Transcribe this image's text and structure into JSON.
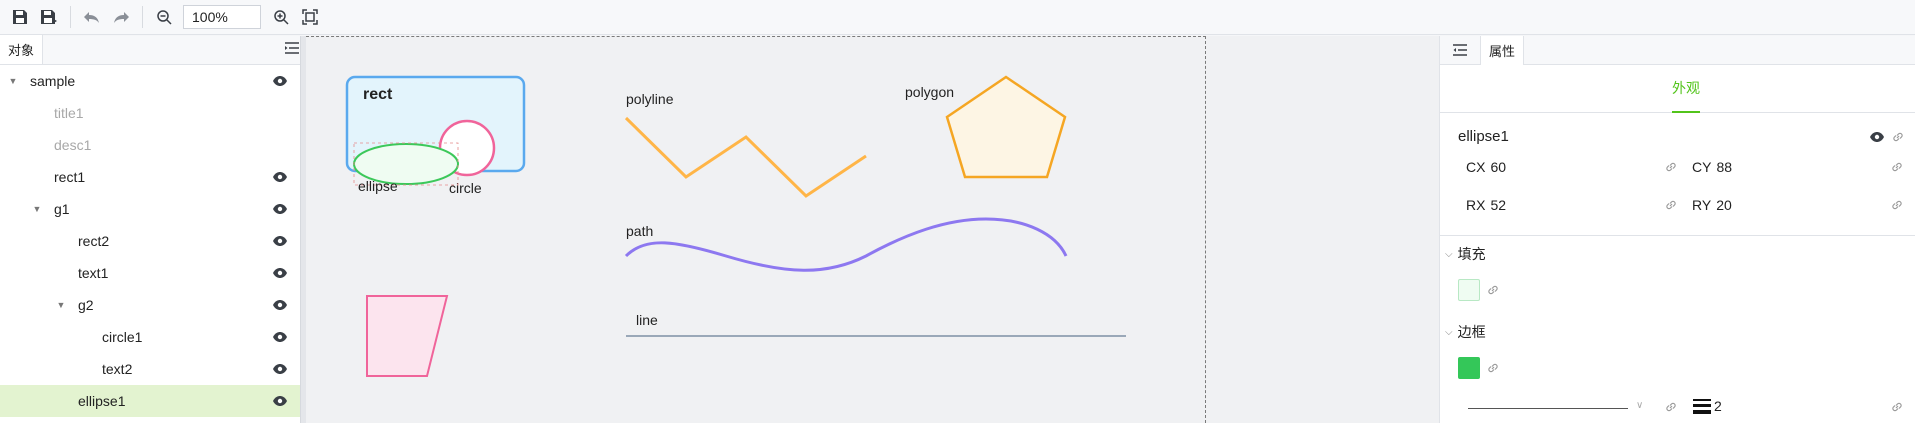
{
  "toolbar": {
    "zoom": "100%",
    "icons": [
      "save-icon",
      "save-as-icon",
      "undo-icon",
      "redo-icon",
      "zoom-out-icon",
      "zoom-in-icon",
      "fit-icon"
    ]
  },
  "left_panel": {
    "tab": "对象",
    "tree": [
      {
        "label": "sample",
        "depth": 0,
        "caret": "open",
        "dim": false,
        "visible": true,
        "selected": false
      },
      {
        "label": "title1",
        "depth": 1,
        "caret": "none",
        "dim": true,
        "visible": false,
        "selected": false
      },
      {
        "label": "desc1",
        "depth": 1,
        "caret": "none",
        "dim": true,
        "visible": false,
        "selected": false
      },
      {
        "label": "rect1",
        "depth": 1,
        "caret": "none",
        "dim": false,
        "visible": true,
        "selected": false
      },
      {
        "label": "g1",
        "depth": 1,
        "caret": "open",
        "dim": false,
        "visible": true,
        "selected": false
      },
      {
        "label": "rect2",
        "depth": 2,
        "caret": "none",
        "dim": false,
        "visible": true,
        "selected": false
      },
      {
        "label": "text1",
        "depth": 2,
        "caret": "none",
        "dim": false,
        "visible": true,
        "selected": false
      },
      {
        "label": "g2",
        "depth": 2,
        "caret": "open",
        "dim": false,
        "visible": true,
        "selected": false
      },
      {
        "label": "circle1",
        "depth": 3,
        "caret": "none",
        "dim": false,
        "visible": true,
        "selected": false
      },
      {
        "label": "text2",
        "depth": 3,
        "caret": "none",
        "dim": false,
        "visible": true,
        "selected": false
      },
      {
        "label": "ellipse1",
        "depth": 2,
        "caret": "none",
        "dim": false,
        "visible": true,
        "selected": true
      }
    ]
  },
  "canvas": {
    "labels": {
      "rect": "rect",
      "ellipse": "ellipse",
      "circle": "circle",
      "polyline": "polyline",
      "polygon": "polygon",
      "path": "path",
      "line": "line"
    },
    "colors": {
      "rect_stroke": "#5aa9ee",
      "rect_fill": "#e3f4fc",
      "circle_stroke": "#f0649a",
      "ellipse_stroke": "#3cc85a",
      "ellipse_fill": "#effcf2",
      "polyline_stroke": "#ffb547",
      "polygon_stroke": "#f5a623",
      "polygon_fill": "#fdf5e4",
      "path_stroke": "#8d78f0",
      "line_stroke": "#9aa8b8",
      "parallelogram_stroke": "#f0649a",
      "parallelogram_fill": "#fce4ee"
    }
  },
  "right_panel": {
    "tab": "属性",
    "subtab": "外观",
    "object_name": "ellipse1",
    "props": {
      "cx_label": "CX",
      "cx": "60",
      "cy_label": "CY",
      "cy": "88",
      "rx_label": "RX",
      "rx": "52",
      "ry_label": "RY",
      "ry": "20"
    },
    "fill": {
      "label": "填充",
      "color": "#effcf2"
    },
    "stroke": {
      "label": "边框",
      "color": "#34c759",
      "width": "2"
    }
  }
}
